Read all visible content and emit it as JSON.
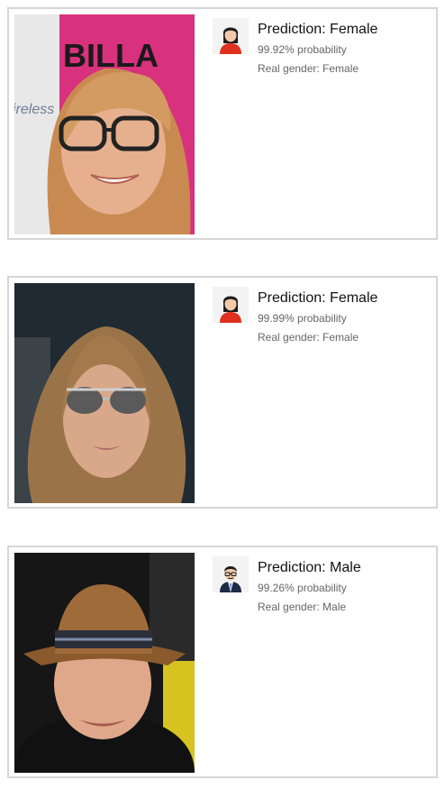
{
  "results": [
    {
      "avatar_icon": "female-avatar-icon",
      "prediction": "Prediction: Female",
      "probability": "99.92% probability",
      "real_gender": "Real gender: Female",
      "photo_text": "BILLA ... ireless"
    },
    {
      "avatar_icon": "female-avatar-icon",
      "prediction": "Prediction: Female",
      "probability": "99.99% probability",
      "real_gender": "Real gender: Female"
    },
    {
      "avatar_icon": "male-avatar-icon",
      "prediction": "Prediction: Male",
      "probability": "99.26% probability",
      "real_gender": "Real gender: Male"
    }
  ],
  "colors": {
    "card_border": "#d6d6d6",
    "title_text": "#111111",
    "meta_text": "#666666",
    "avatar_bg": "#f3f3f3",
    "female_shirt": "#e0301e",
    "male_suit": "#1f2a44"
  }
}
